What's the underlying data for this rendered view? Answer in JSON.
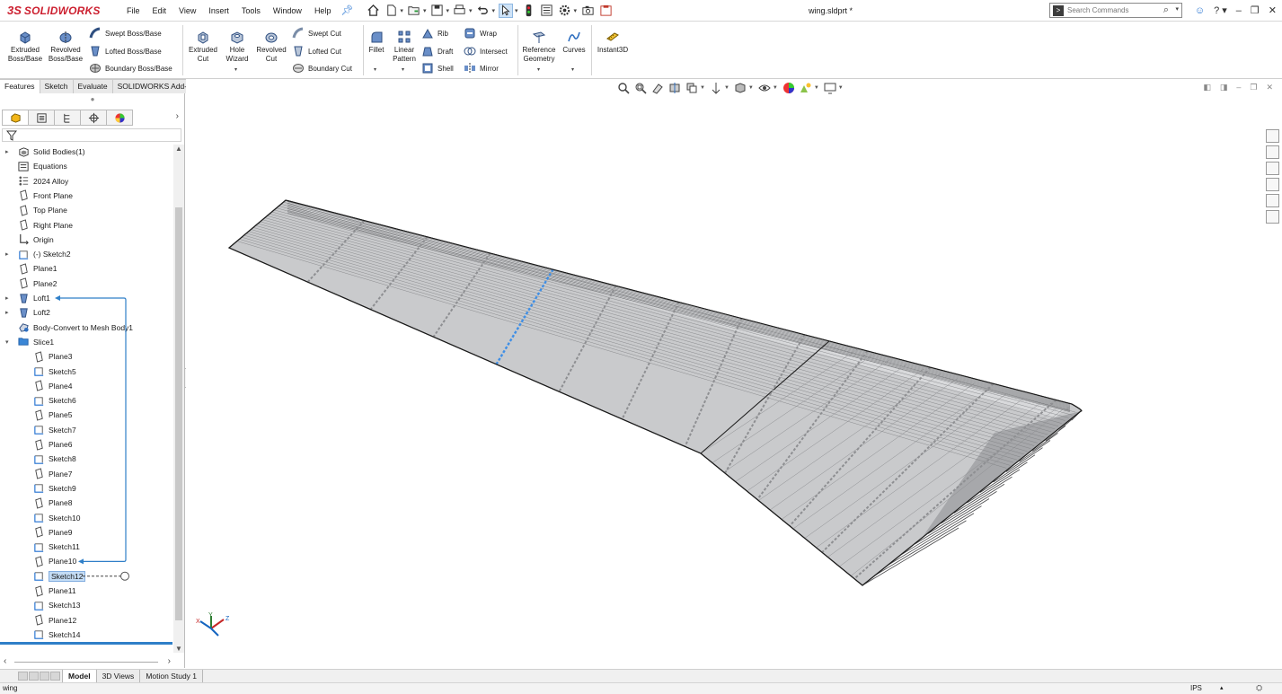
{
  "app": {
    "brand_prefix": "3S",
    "brand_name": "SOLIDWORKS",
    "document_title": "wing.sldprt *"
  },
  "menu": [
    "File",
    "Edit",
    "View",
    "Insert",
    "Tools",
    "Window",
    "Help"
  ],
  "search": {
    "placeholder": "Search Commands"
  },
  "commands": {
    "extruded_boss": "Extruded Boss/Base",
    "revolved_boss": "Revolved Boss/Base",
    "swept_boss": "Swept Boss/Base",
    "lofted_boss": "Lofted Boss/Base",
    "boundary_boss": "Boundary Boss/Base",
    "extruded_cut": "Extruded Cut",
    "hole_wizard": "Hole Wizard",
    "revolved_cut": "Revolved Cut",
    "swept_cut": "Swept Cut",
    "lofted_cut": "Lofted Cut",
    "boundary_cut": "Boundary Cut",
    "fillet": "Fillet",
    "linear_pattern": "Linear Pattern",
    "rib": "Rib",
    "wrap": "Wrap",
    "draft": "Draft",
    "intersect": "Intersect",
    "shell": "Shell",
    "mirror": "Mirror",
    "reference_geometry": "Reference Geometry",
    "curves": "Curves",
    "instant3d": "Instant3D"
  },
  "tabs": [
    "Features",
    "Sketch",
    "Evaluate",
    "SOLIDWORKS Add-Ins"
  ],
  "active_tab": "Features",
  "tree": [
    {
      "label": "Solid Bodies(1)",
      "icon": "solid-bodies-icon",
      "indent": 0,
      "expandable": true
    },
    {
      "label": "Equations",
      "icon": "equations-icon",
      "indent": 0,
      "expandable": false
    },
    {
      "label": "2024 Alloy",
      "icon": "material-icon",
      "indent": 0,
      "expandable": false
    },
    {
      "label": "Front Plane",
      "icon": "plane-icon",
      "indent": 0,
      "expandable": false
    },
    {
      "label": "Top Plane",
      "icon": "plane-icon",
      "indent": 0,
      "expandable": false
    },
    {
      "label": "Right Plane",
      "icon": "plane-icon",
      "indent": 0,
      "expandable": false
    },
    {
      "label": "Origin",
      "icon": "origin-icon",
      "indent": 0,
      "expandable": false
    },
    {
      "label": "(-) Sketch2",
      "icon": "sketch-icon",
      "indent": 0,
      "expandable": true
    },
    {
      "label": "Plane1",
      "icon": "plane-icon",
      "indent": 0,
      "expandable": false
    },
    {
      "label": "Plane2",
      "icon": "plane-icon",
      "indent": 0,
      "expandable": false
    },
    {
      "label": "Loft1",
      "icon": "loft-icon",
      "indent": 0,
      "expandable": true
    },
    {
      "label": "Loft2",
      "icon": "loft-icon",
      "indent": 0,
      "expandable": true
    },
    {
      "label": "Body-Convert to Mesh Body1",
      "icon": "mesh-convert-icon",
      "indent": 0,
      "expandable": false
    },
    {
      "label": "Slice1",
      "icon": "folder-icon",
      "indent": 0,
      "expandable": true,
      "expanded": true
    },
    {
      "label": "Plane3",
      "icon": "plane-icon",
      "indent": 1,
      "expandable": false
    },
    {
      "label": "Sketch5",
      "icon": "sketch-icon",
      "indent": 1,
      "expandable": false
    },
    {
      "label": "Plane4",
      "icon": "plane-icon",
      "indent": 1,
      "expandable": false
    },
    {
      "label": "Sketch6",
      "icon": "sketch-icon",
      "indent": 1,
      "expandable": false
    },
    {
      "label": "Plane5",
      "icon": "plane-icon",
      "indent": 1,
      "expandable": false
    },
    {
      "label": "Sketch7",
      "icon": "sketch-icon",
      "indent": 1,
      "expandable": false
    },
    {
      "label": "Plane6",
      "icon": "plane-icon",
      "indent": 1,
      "expandable": false
    },
    {
      "label": "Sketch8",
      "icon": "sketch-icon",
      "indent": 1,
      "expandable": false
    },
    {
      "label": "Plane7",
      "icon": "plane-icon",
      "indent": 1,
      "expandable": false
    },
    {
      "label": "Sketch9",
      "icon": "sketch-icon",
      "indent": 1,
      "expandable": false
    },
    {
      "label": "Plane8",
      "icon": "plane-icon",
      "indent": 1,
      "expandable": false
    },
    {
      "label": "Sketch10",
      "icon": "sketch-icon",
      "indent": 1,
      "expandable": false
    },
    {
      "label": "Plane9",
      "icon": "plane-icon",
      "indent": 1,
      "expandable": false
    },
    {
      "label": "Sketch11",
      "icon": "sketch-icon",
      "indent": 1,
      "expandable": false
    },
    {
      "label": "Plane10",
      "icon": "plane-icon",
      "indent": 1,
      "expandable": false
    },
    {
      "label": "Sketch12",
      "icon": "sketch-icon",
      "indent": 1,
      "expandable": false,
      "selected": true
    },
    {
      "label": "Plane11",
      "icon": "plane-icon",
      "indent": 1,
      "expandable": false
    },
    {
      "label": "Sketch13",
      "icon": "sketch-icon",
      "indent": 1,
      "expandable": false
    },
    {
      "label": "Plane12",
      "icon": "plane-icon",
      "indent": 1,
      "expandable": false
    },
    {
      "label": "Sketch14",
      "icon": "sketch-icon",
      "indent": 1,
      "expandable": false
    }
  ],
  "bottom_tabs": [
    "Model",
    "3D Views",
    "Motion Study 1"
  ],
  "active_bottom_tab": "Model",
  "status": {
    "document_name": "wing",
    "units": "IPS"
  },
  "colors": {
    "brand_red": "#cc1f2f",
    "selection_blue": "#2f7fc8",
    "wing_surface": "#c9cacc"
  }
}
